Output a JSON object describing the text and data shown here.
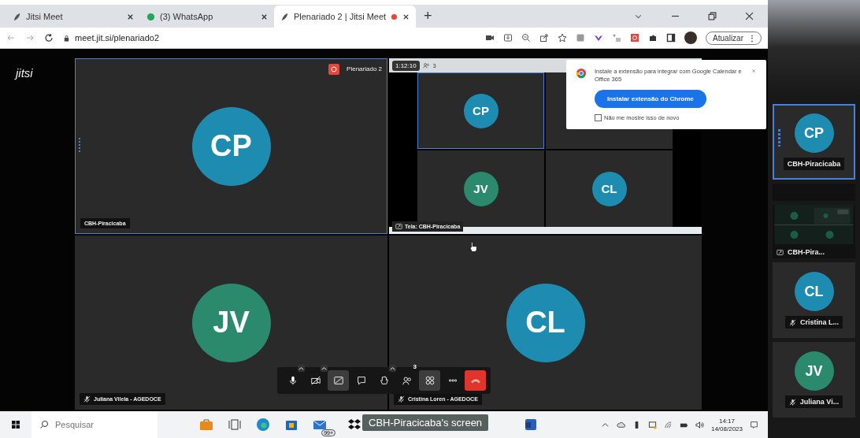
{
  "browser": {
    "tabs": [
      {
        "title": "Jitsi Meet",
        "selected": false,
        "kind": "jitsi"
      },
      {
        "title": "(3) WhatsApp",
        "selected": false,
        "kind": "whatsapp"
      },
      {
        "title": "Plenariado 2 | Jitsi Meet",
        "selected": true,
        "kind": "jitsi",
        "recording": true
      }
    ],
    "new_tab": "+",
    "address": "meet.jit.si/plenariado2",
    "update_button": "Atualizar",
    "update_menu": "⋮"
  },
  "meeting": {
    "logo": "jitsi",
    "room_label": "Plenariado 2",
    "recording": true,
    "tiles": [
      {
        "kind": "avatar",
        "initials": "CP",
        "name": "CBH-Piracicaba",
        "color": "#1e8cb0",
        "muted": false,
        "active": true
      },
      {
        "kind": "screen",
        "timer": "1:12:10",
        "participants": "3",
        "label": "Tela: CBH-Piracicaba",
        "mini": [
          {
            "kind": "avatar",
            "initials": "CP",
            "color": "#1e8cb0"
          },
          {
            "kind": "screen"
          },
          {
            "kind": "avatar",
            "initials": "JV",
            "color": "#2b8a6c"
          },
          {
            "kind": "avatar",
            "initials": "CL",
            "color": "#1e8cb0"
          }
        ],
        "active": false
      },
      {
        "kind": "avatar",
        "initials": "JV",
        "name": "Juliana Vilela - AGEDOCE",
        "color": "#2b8a6c",
        "muted": true,
        "active": false
      },
      {
        "kind": "avatar",
        "initials": "CL",
        "name": "Cristina Loren - AGEDOCE",
        "color": "#1e8cb0",
        "muted": true,
        "active": false
      }
    ],
    "toolbar": [
      {
        "kind": "mic",
        "active": false,
        "caret": true
      },
      {
        "kind": "camera",
        "active": false,
        "caret": true
      },
      {
        "kind": "screenshare",
        "active": true,
        "caret": false
      },
      {
        "kind": "chat",
        "active": false,
        "caret": false
      },
      {
        "kind": "hand",
        "active": false,
        "caret": true
      },
      {
        "kind": "participants",
        "active": false,
        "caret": false,
        "badge": "3"
      },
      {
        "kind": "tileview",
        "active": true,
        "caret": false
      },
      {
        "kind": "more",
        "active": false,
        "caret": false
      },
      {
        "kind": "hangup",
        "active": false,
        "caret": false
      }
    ]
  },
  "popup": {
    "text": "Instale a extensão para integrar com Google Calendar e Office 365",
    "button": "Instalar extensão do Chrome",
    "checkbox": {
      "label": "Não me mostre isso de novo",
      "checked": false
    }
  },
  "filmstrip": [
    {
      "kind": "avatar",
      "initials": "CP",
      "name": "CBH-Piracicaba",
      "color": "#1e8cb0",
      "muted": false,
      "active": true
    },
    {
      "kind": "blank"
    },
    {
      "kind": "screen",
      "name": "CBH-Pira..."
    },
    {
      "kind": "avatar",
      "initials": "CL",
      "name": "Cristina L...",
      "color": "#1e8cb0",
      "muted": true,
      "active": false
    },
    {
      "kind": "avatar",
      "initials": "JV",
      "name": "Juliana Vi...",
      "color": "#2b8a6c",
      "muted": true,
      "active": false
    }
  ],
  "taskbar": {
    "search": {
      "placeholder": "Pesquisar"
    },
    "mail_badge": "99+",
    "tooltip": "CBH-Piracicaba's screen",
    "time": "14:17",
    "date": "14/08/2023"
  }
}
